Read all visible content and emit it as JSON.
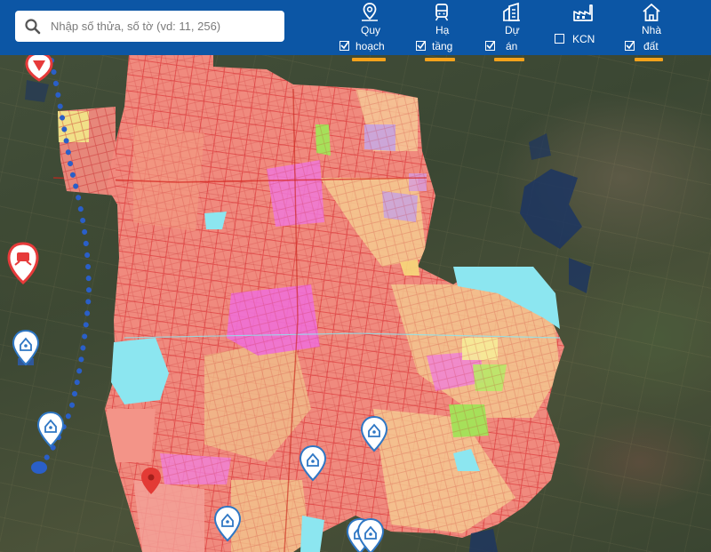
{
  "search": {
    "placeholder": "Nhập số thửa, số tờ (vd: 11, 256)"
  },
  "layers": [
    {
      "id": "quy-hoach",
      "label_line1": "Quy",
      "label_line2": "hoạch",
      "checked": true,
      "icon": "map-pin-icon"
    },
    {
      "id": "ha-tang",
      "label_line1": "Hạ",
      "label_line2": "tầng",
      "checked": true,
      "icon": "train-icon"
    },
    {
      "id": "du-an",
      "label_line1": "Dự",
      "label_line2": "án",
      "checked": true,
      "icon": "buildings-icon"
    },
    {
      "id": "kcn",
      "label_line1": "",
      "label_line2": "KCN",
      "checked": false,
      "icon": "factory-icon"
    },
    {
      "id": "nha-dat",
      "label_line1": "Nhà",
      "label_line2": "đất",
      "checked": true,
      "icon": "house-icon"
    }
  ],
  "colors": {
    "header": "#0c56a5",
    "accent": "#f5a21b",
    "zoning_residential": "#f08a7e",
    "zoning_commercial": "#ee6fd6",
    "zoning_agri": "#f4c78f",
    "water": "#8ce6f0",
    "green": "#a6e05a",
    "marker_red": "#e63a3a",
    "marker_blue": "#2f77c4"
  }
}
